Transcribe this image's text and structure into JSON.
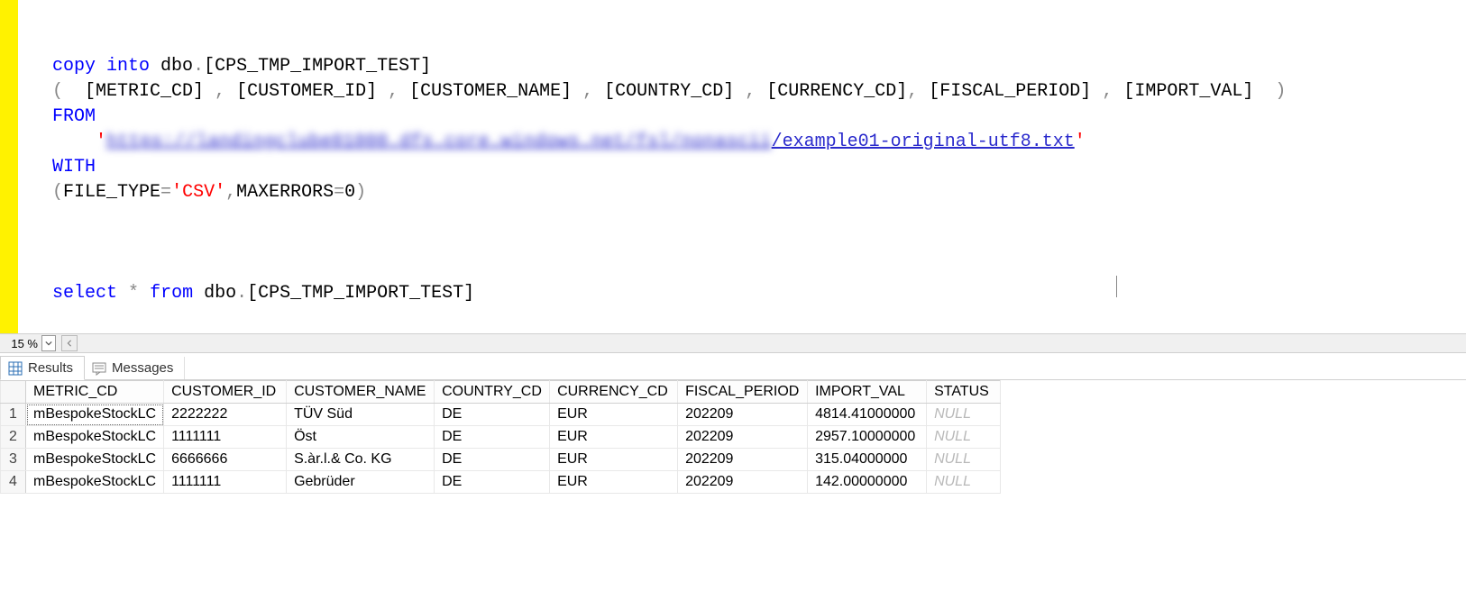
{
  "sql": {
    "l1": {
      "a": "copy",
      "b": " ",
      "c": "into",
      "d": " dbo",
      "e": ".",
      "f": "[CPS_TMP_IMPORT_TEST]"
    },
    "l2": {
      "a": "(",
      "b": "  [METRIC_CD] ",
      "c": ",",
      "d": " [CUSTOMER_ID] ",
      "e": ",",
      "f": " [CUSTOMER_NAME] ",
      "g": ",",
      "h": " [COUNTRY_CD] ",
      "i": ",",
      "j": " [CURRENCY_CD]",
      "k": ",",
      "l": " [FISCAL_PERIOD] ",
      "m": ",",
      "n": " [IMPORT_VAL]  ",
      "o": ")"
    },
    "l3": "FROM",
    "l4": {
      "prefix": "    ",
      "q1": "'",
      "blur": "https://landingclube01000.dfs.core.windows.net/fsl/nonascii",
      "vis": "/example01-original-utf8.txt",
      "q2": "'"
    },
    "l5": "WITH",
    "l6": {
      "a": "(",
      "b": "FILE_TYPE",
      "c": "=",
      "d": "'CSV'",
      "e": ",",
      "f": "MAXERRORS",
      "g": "=",
      "h": "0",
      "i": ")"
    },
    "l7": "",
    "l8": "",
    "l9": "",
    "l10": {
      "a": "select",
      "b": " ",
      "c": "*",
      "d": " ",
      "e": "from",
      "f": " dbo",
      "g": ".",
      "h": "[CPS_TMP_IMPORT_TEST]"
    }
  },
  "status": {
    "zoom": "15 %"
  },
  "tabs": {
    "results": "Results",
    "messages": "Messages"
  },
  "grid": {
    "headers": [
      "METRIC_CD",
      "CUSTOMER_ID",
      "CUSTOMER_NAME",
      "COUNTRY_CD",
      "CURRENCY_CD",
      "FISCAL_PERIOD",
      "IMPORT_VAL",
      "STATUS"
    ],
    "rows": [
      {
        "n": "1",
        "c": [
          "mBespokeStockLC",
          "2222222",
          "TÜV Süd",
          "DE",
          "EUR",
          "202209",
          "4814.41000000",
          "NULL"
        ]
      },
      {
        "n": "2",
        "c": [
          "mBespokeStockLC",
          "1111111",
          "Öst",
          "DE",
          "EUR",
          "202209",
          "2957.10000000",
          "NULL"
        ]
      },
      {
        "n": "3",
        "c": [
          "mBespokeStockLC",
          "6666666",
          "S.àr.l.& Co. KG",
          "DE",
          "EUR",
          "202209",
          "315.04000000",
          "NULL"
        ]
      },
      {
        "n": "4",
        "c": [
          "mBespokeStockLC",
          "1111111",
          "Gebrüder",
          "DE",
          "EUR",
          "202209",
          "142.00000000",
          "NULL"
        ]
      }
    ]
  }
}
